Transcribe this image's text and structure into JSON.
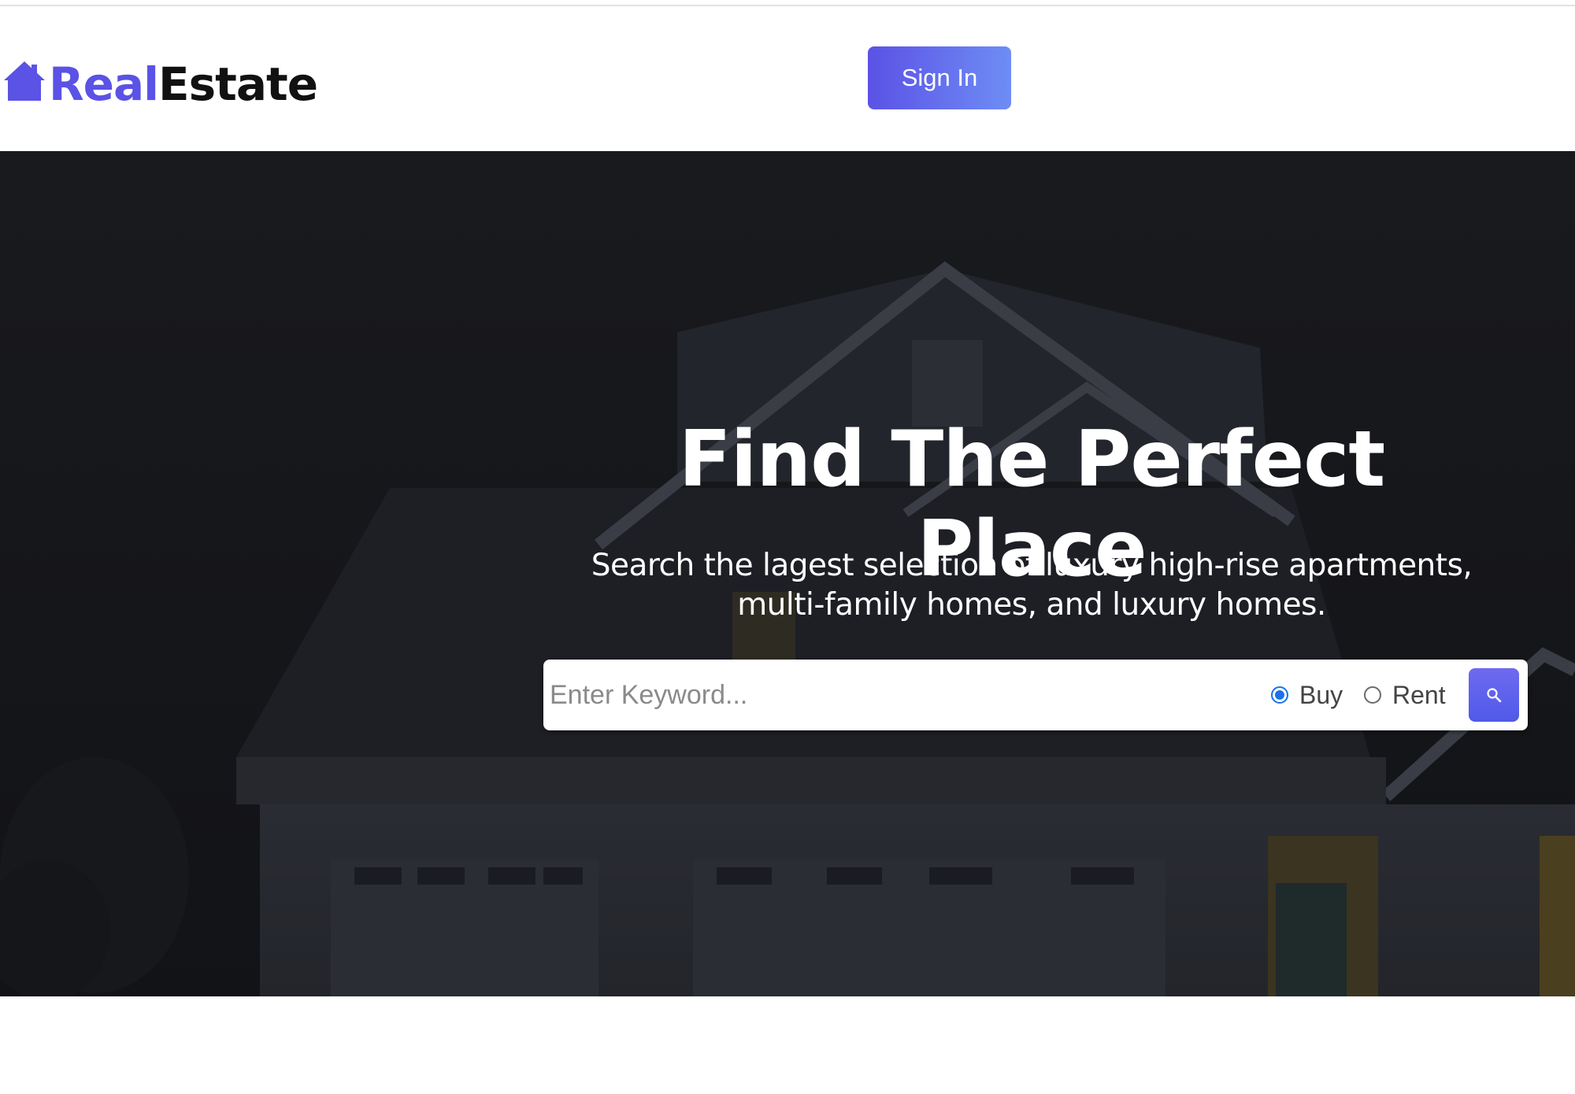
{
  "header": {
    "brand_part1": "Real",
    "brand_part2": "Estate",
    "brand_icon": "house-icon",
    "signin_label": "Sign In"
  },
  "hero": {
    "title": "Find The Perfect Place",
    "subtitle_line1": "Search the lagest selection of luxury high-rise apartments,",
    "subtitle_line2": "multi-family homes, and luxury homes."
  },
  "search": {
    "placeholder": "Enter Keyword...",
    "options": [
      "Buy",
      "Rent"
    ],
    "selected": "Buy",
    "button_icon": "search-icon"
  },
  "colors": {
    "accent": "#5b52e6",
    "accent_light": "#6e8df4",
    "hero_overlay": "#14151a",
    "radio_selected": "#1a73e8"
  }
}
